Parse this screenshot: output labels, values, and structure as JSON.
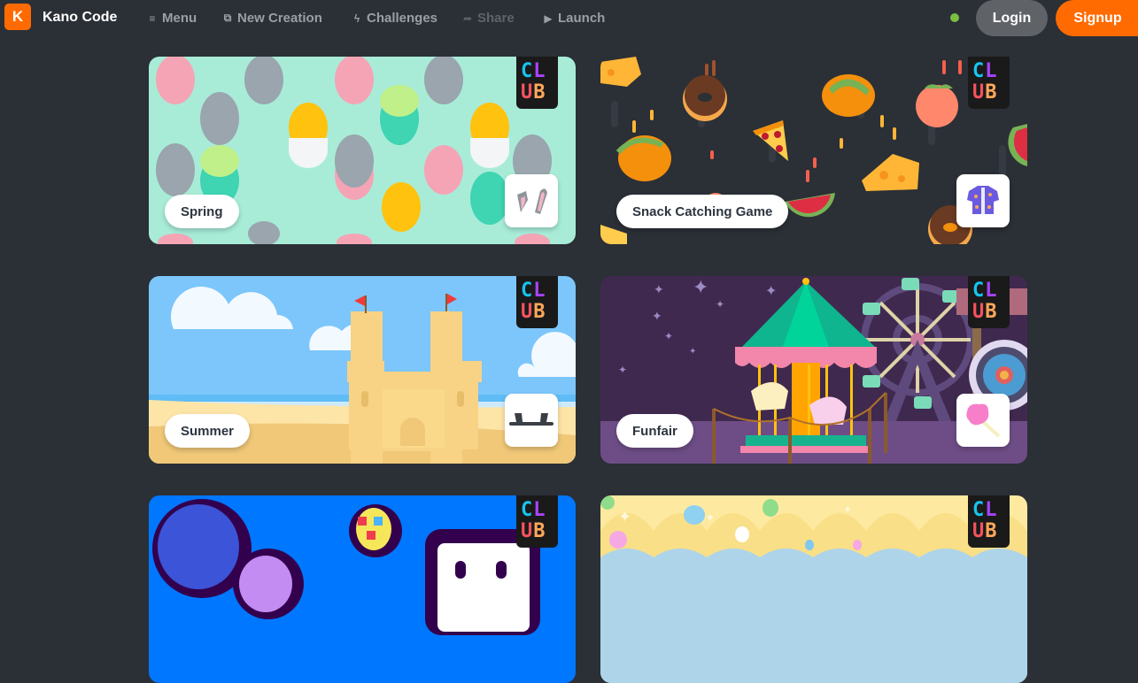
{
  "app": {
    "logo_letter": "K",
    "title": "Kano Code"
  },
  "nav": [
    {
      "label": "Menu",
      "icon": "menu-icon",
      "glyph": "≡",
      "disabled": false
    },
    {
      "label": "New Creation",
      "icon": "new-creation-icon",
      "glyph": "⧉",
      "disabled": false
    },
    {
      "label": "Challenges",
      "icon": "lightning-icon",
      "glyph": "ϟ",
      "disabled": false
    },
    {
      "label": "Share",
      "icon": "share-arrow-icon",
      "glyph": "➦",
      "disabled": true
    },
    {
      "label": "Launch",
      "icon": "launch-play-icon",
      "glyph": "▶",
      "disabled": false
    }
  ],
  "status": {
    "color": "#7bc043"
  },
  "auth": {
    "login_label": "Login",
    "signup_label": "Signup"
  },
  "colors": {
    "brand": "#ff6b00",
    "background": "#2b2f36"
  },
  "club_badge": {
    "letters": [
      "C",
      "L",
      "U",
      "B"
    ]
  },
  "cards": [
    {
      "title": "Spring",
      "theme_color": "#a8ecd8",
      "item_icon": "bunny-ears-icon"
    },
    {
      "title": "Snack Catching Game",
      "theme_color": "#2b2f36",
      "item_icon": "hawaiian-shirt-icon"
    },
    {
      "title": "Summer",
      "theme_color": "#7cc6fb",
      "item_icon": "sunglasses-icon"
    },
    {
      "title": "Funfair",
      "theme_color": "#40294f",
      "item_icon": "cotton-candy-icon"
    },
    {
      "title": "",
      "theme_color": "#0077ff",
      "item_icon": ""
    },
    {
      "title": "",
      "theme_color": "#fdeaa0",
      "item_icon": ""
    }
  ]
}
